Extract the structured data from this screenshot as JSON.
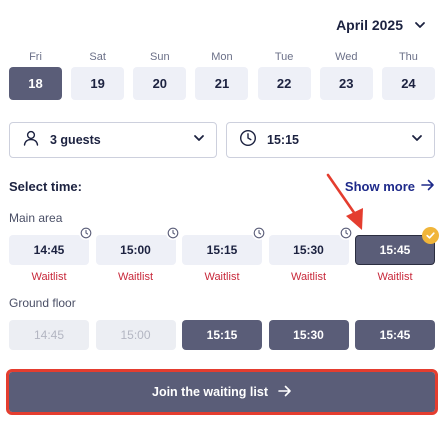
{
  "header": {
    "month": "April 2025",
    "chevron_icon": "chevron-down-icon"
  },
  "days": [
    {
      "name": "Fri",
      "date": "18",
      "selected": true
    },
    {
      "name": "Sat",
      "date": "19",
      "selected": false
    },
    {
      "name": "Sun",
      "date": "20",
      "selected": false
    },
    {
      "name": "Mon",
      "date": "21",
      "selected": false
    },
    {
      "name": "Tue",
      "date": "22",
      "selected": false
    },
    {
      "name": "Wed",
      "date": "23",
      "selected": false
    },
    {
      "name": "Thu",
      "date": "24",
      "selected": false
    }
  ],
  "selectors": {
    "guests": {
      "icon": "person-icon",
      "value": "3 guests"
    },
    "time": {
      "icon": "clock-icon",
      "value": "15:15"
    }
  },
  "select_time": {
    "title": "Select time:",
    "show_more": "Show more"
  },
  "main_area": {
    "label": "Main area",
    "slots": [
      {
        "time": "14:45",
        "note": "Waitlist"
      },
      {
        "time": "15:00",
        "note": "Waitlist"
      },
      {
        "time": "15:15",
        "note": "Waitlist"
      },
      {
        "time": "15:30",
        "note": "Waitlist"
      },
      {
        "time": "15:45",
        "note": "Waitlist"
      }
    ]
  },
  "ground_floor": {
    "label": "Ground floor",
    "slots": [
      {
        "time": "14:45"
      },
      {
        "time": "15:00"
      },
      {
        "time": "15:15"
      },
      {
        "time": "15:30"
      },
      {
        "time": "15:45"
      }
    ]
  },
  "join_button": {
    "label": "Join the waiting list"
  },
  "colors": {
    "accent_dark": "#5a5d78",
    "link": "#1e2a8a",
    "waitlist": "#c8283a",
    "check_badge": "#f0b53a",
    "annotation": "#e43d2f"
  }
}
